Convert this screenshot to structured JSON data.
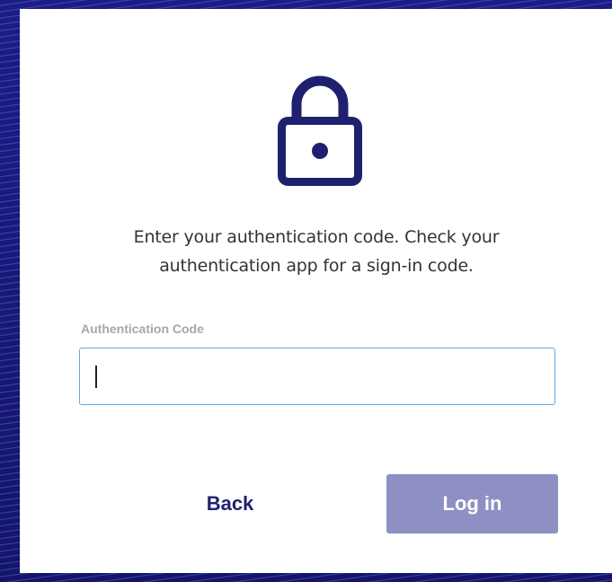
{
  "auth": {
    "message_line1": "Enter your authentication code. Check your",
    "message_line2": "authentication app for a sign-in code.",
    "field_label": "Authentication Code",
    "field_value": "",
    "back_label": "Back",
    "login_label": "Log in"
  },
  "icons": {
    "lock": "lock-icon"
  },
  "colors": {
    "brand_navy": "#1f2170",
    "login_button_disabled": "#8e8fc3",
    "input_focus_border": "#5ea9e6",
    "label_gray": "#a7a7a7",
    "text": "#333333"
  }
}
